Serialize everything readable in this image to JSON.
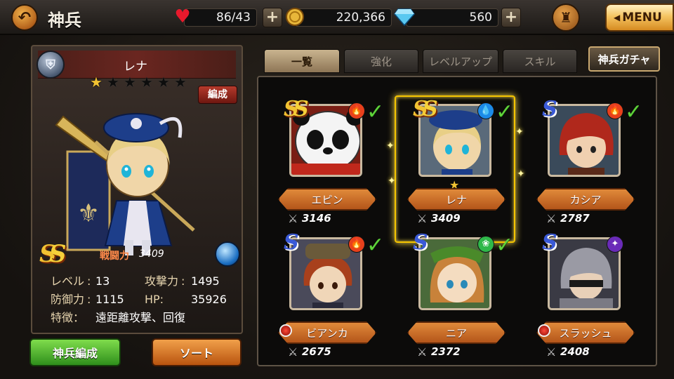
{
  "header": {
    "title": "神兵",
    "stamina": "86/43",
    "gold": "220,366",
    "gems": "560",
    "menu_label": "MENU"
  },
  "selected_unit": {
    "name": "レナ",
    "stars_filled": 1,
    "stars_total": 6,
    "formation_tag": "編成",
    "power_label": "戦闘力",
    "power": "3409",
    "level_label": "レベル",
    "level": "13",
    "attack_label": "攻撃力",
    "attack": "1495",
    "defense_label": "防御力",
    "defense": "1115",
    "hp_label": "HP:",
    "hp": "35926",
    "trait_label": "特徴：",
    "trait": "遠距離攻撃、回復"
  },
  "tabs": [
    {
      "label": "一覧",
      "active": true
    },
    {
      "label": "強化",
      "active": false
    },
    {
      "label": "レベルアップ",
      "active": false
    },
    {
      "label": "スキル",
      "active": false
    }
  ],
  "gacha_label": "神兵ガチャ",
  "buttons": {
    "formation": "神兵編成",
    "sort": "ソート"
  },
  "units": [
    {
      "name": "エピン",
      "power": "3146",
      "rank": "SS",
      "element": "fire",
      "element_color": "#e8401c",
      "checked": true
    },
    {
      "name": "レナ",
      "power": "3409",
      "rank": "SS",
      "element": "water",
      "element_color": "#1c8ae8",
      "checked": true,
      "selected": true
    },
    {
      "name": "カシア",
      "power": "2787",
      "rank": "S",
      "element": "fire",
      "element_color": "#e8401c",
      "checked": true
    },
    {
      "name": "ビアンカ",
      "power": "2675",
      "rank": "S",
      "element": "fire",
      "element_color": "#e8401c",
      "checked": true
    },
    {
      "name": "ニア",
      "power": "2372",
      "rank": "S",
      "element": "wind",
      "element_color": "#2fb84a",
      "checked": true
    },
    {
      "name": "スラッシュ",
      "power": "2408",
      "rank": "S",
      "element": "dark",
      "element_color": "#6a2bb8",
      "checked": false
    }
  ]
}
